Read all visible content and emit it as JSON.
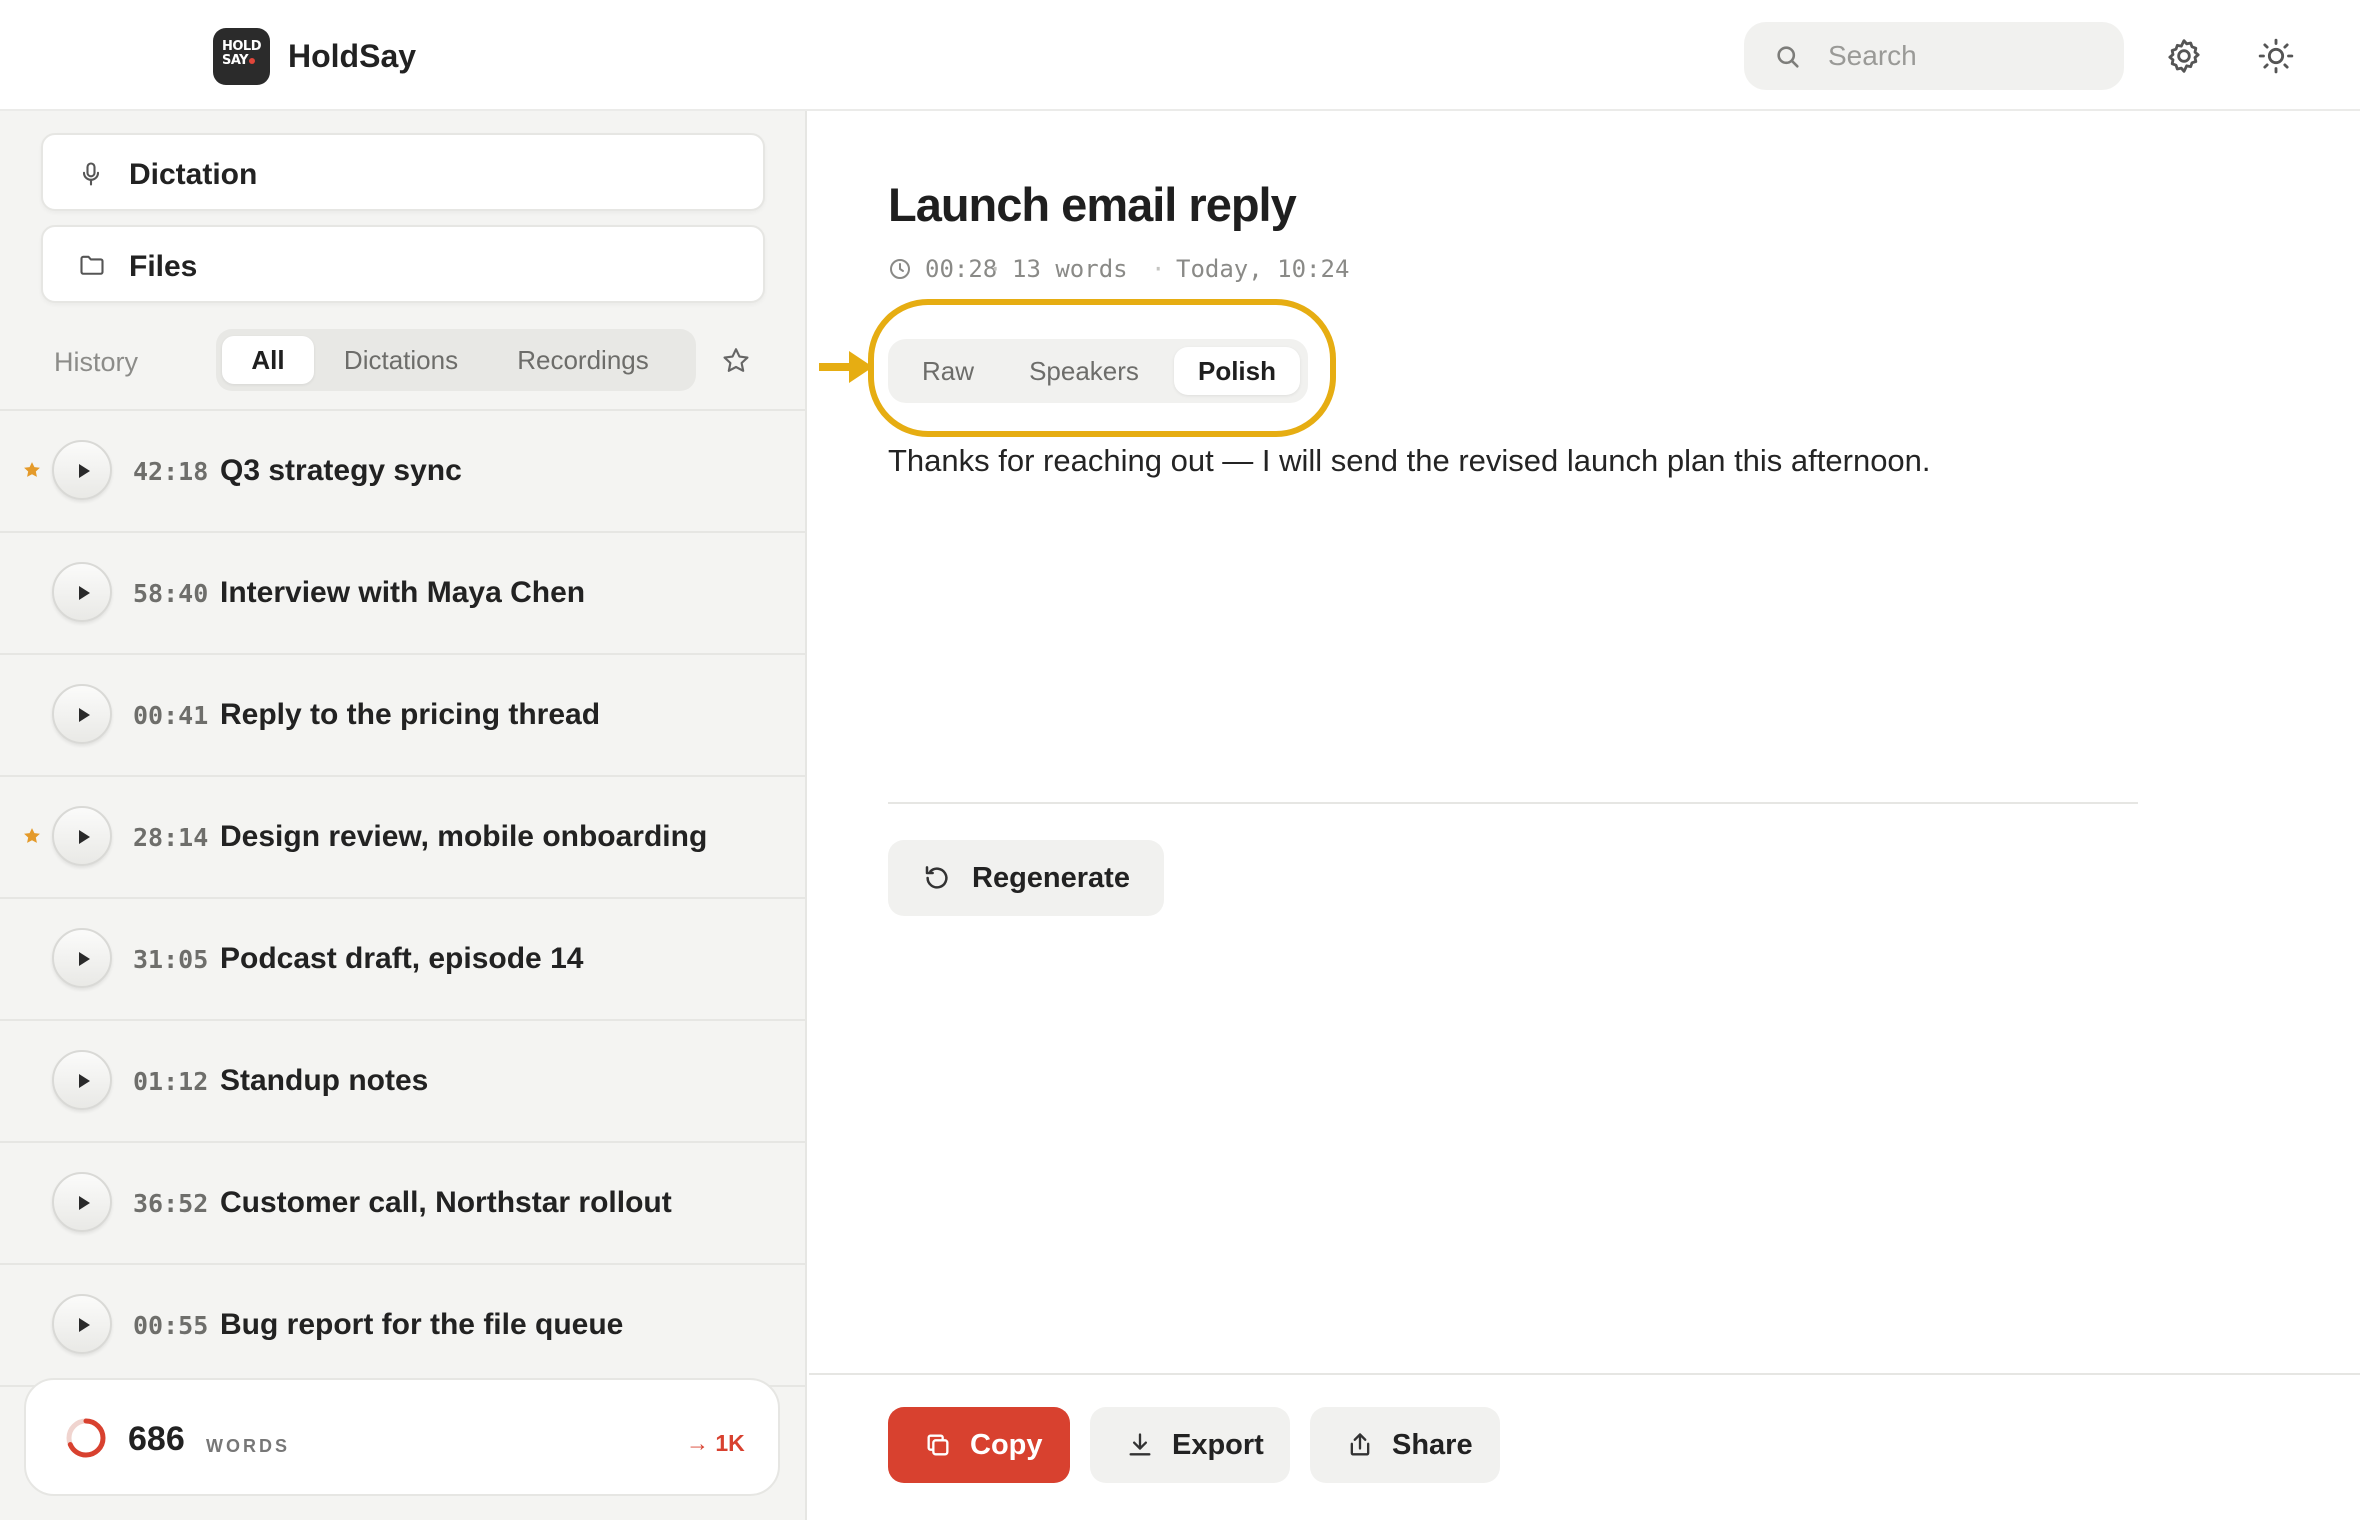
{
  "header": {
    "logo_text_line1": "HOLD",
    "logo_text_line2": "SAY",
    "app_name": "HoldSay",
    "search_placeholder": "Search"
  },
  "sidebar": {
    "nav": [
      {
        "label": "Dictation",
        "icon": "microphone-icon"
      },
      {
        "label": "Files",
        "icon": "folder-icon"
      }
    ],
    "history_label": "History",
    "filters": [
      "All",
      "Dictations",
      "Recordings"
    ],
    "active_filter": "All",
    "items": [
      {
        "duration": "42:18",
        "title": "Q3 strategy sync",
        "starred": true
      },
      {
        "duration": "58:40",
        "title": "Interview with Maya Chen",
        "starred": false
      },
      {
        "duration": "00:41",
        "title": "Reply to the pricing thread",
        "starred": false
      },
      {
        "duration": "28:14",
        "title": "Design review, mobile onboarding",
        "starred": true
      },
      {
        "duration": "31:05",
        "title": "Podcast draft, episode 14",
        "starred": false
      },
      {
        "duration": "01:12",
        "title": "Standup notes",
        "starred": false
      },
      {
        "duration": "36:52",
        "title": "Customer call, Northstar rollout",
        "starred": false
      },
      {
        "duration": "00:55",
        "title": "Bug report for the file queue",
        "starred": false
      }
    ],
    "usage": {
      "count": "686",
      "unit": "WORDS",
      "goal": "→ 1K",
      "progress": 0.686
    }
  },
  "main": {
    "title": "Launch email reply",
    "meta": {
      "duration": "00:28",
      "words": "13 words",
      "time": "Today, 10:24",
      "separator": "·"
    },
    "modes": [
      "Raw",
      "Speakers",
      "Polish"
    ],
    "active_mode": "Polish",
    "body": "Thanks for reaching out — I will send the revised launch plan this afternoon.",
    "regenerate_label": "Regenerate",
    "actions": {
      "copy": "Copy",
      "export": "Export",
      "share": "Share"
    }
  },
  "colors": {
    "accent_red": "#d8412f",
    "highlight_yellow": "#e6ad12",
    "star_orange": "#e49a2a"
  }
}
